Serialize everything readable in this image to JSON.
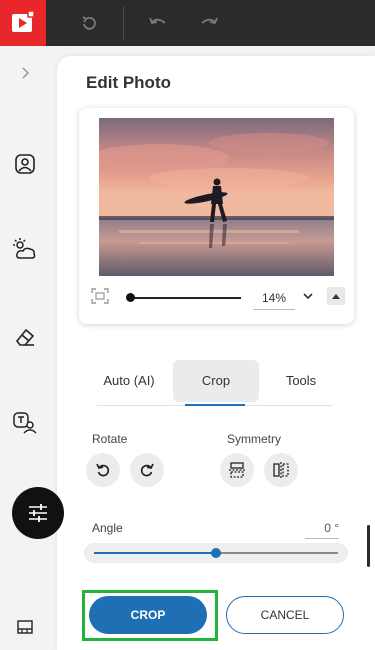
{
  "panel": {
    "title": "Edit Photo"
  },
  "zoom": {
    "value": "14%"
  },
  "tabs": [
    {
      "label": "Auto (AI)"
    },
    {
      "label": "Crop",
      "active": true
    },
    {
      "label": "Tools"
    }
  ],
  "rotate": {
    "label": "Rotate"
  },
  "symmetry": {
    "label": "Symmetry"
  },
  "angle": {
    "label": "Angle",
    "value": "0 °",
    "level": 0.5
  },
  "actions": {
    "crop_label": "CROP",
    "cancel_label": "CANCEL"
  },
  "colors": {
    "brand": "#e8272a",
    "accent": "#1f6fb5",
    "highlight": "#22b33a",
    "topbar": "#2b2b2b"
  },
  "icons": {
    "topbar": [
      "app-logo-icon",
      "refresh-icon",
      "undo-icon",
      "redo-icon"
    ],
    "rail": [
      "chevron-right-icon",
      "portrait-icon",
      "weather-icon",
      "eraser-icon",
      "text-person-icon",
      "adjust-sliders-icon",
      "gallery-icon"
    ]
  }
}
